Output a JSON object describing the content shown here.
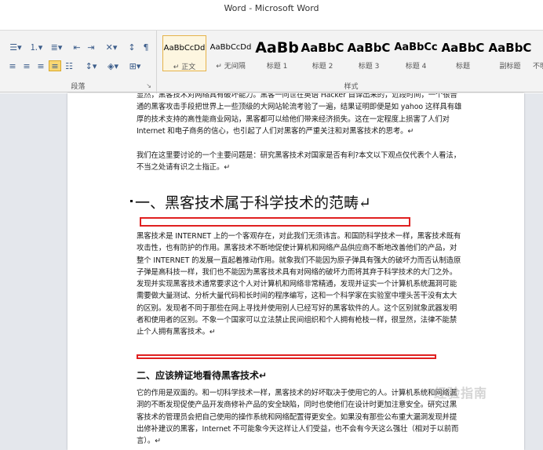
{
  "window": {
    "title": "Word - Microsoft Word"
  },
  "ribbon": {
    "paragraph_group": {
      "label": "段落",
      "icons": [
        "bullets-icon",
        "numbering-icon",
        "multilevel-list-icon",
        "decrease-indent-icon",
        "increase-indent-icon",
        "chinese-layout-icon",
        "sort-icon",
        "show-marks-icon",
        "align-left-icon",
        "align-center-icon",
        "align-right-icon",
        "justify-icon",
        "distributed-icon",
        "line-spacing-icon",
        "shading-icon",
        "borders-icon"
      ]
    },
    "styles_group": {
      "label": "样式",
      "items": [
        {
          "preview": "AaBbCcDd",
          "name": "↵ 正文",
          "selected": true
        },
        {
          "preview": "AaBbCcDd",
          "name": "↵ 无间隔",
          "selected": false
        },
        {
          "preview": "AaBb",
          "name": "标题 1",
          "selected": false
        },
        {
          "preview": "AaBbC",
          "name": "标题 2",
          "selected": false
        },
        {
          "preview": "AaBbC",
          "name": "标题 3",
          "selected": false
        },
        {
          "preview": "AaBbCc",
          "name": "标题 4",
          "selected": false
        },
        {
          "preview": "AaBbC",
          "name": "标题",
          "selected": false
        },
        {
          "preview": "AaBbC",
          "name": "副标题",
          "selected": false
        },
        {
          "preview": "",
          "name": "不明",
          "selected": false
        }
      ]
    }
  },
  "document": {
    "para1": "显然，黑客技术对网络具有破坏能力。黑客一问世在英语 Hacker 首译出来的，近段时间，一个很普通的黑客攻击手段把世界上一些顶级的大网站轮流考验了一遍，结果证明即便是如 yahoo 这样具有雄厚的技术支持的高性能商业网站，黑客都可以给他们带来经济损失。这在一定程度上损害了人们对 Internet 和电子商务的信心，也引起了人们对黑客的严重关注和对黑客技术的思考。↵",
    "para2": "我们在这里要讨论的一个主要问题是：研究黑客技术对国家是否有利?本文以下观点仅代表个人看法，不当之处请有识之士指正。↵",
    "heading1": "一、黑客技术属于科学技术的范畴↵",
    "para3": "黑客技术是 INTERNET 上的一个客观存在，对此我们无须讳言。和国防科学技术一样，黑客技术既有攻击性，也有防护的作用。黑客技术不断地促使计算机和网络产品供应商不断地改善他们的产品，对整个 INTERNET 的发展一直起着推动作用。就象我们不能因为原子弹具有强大的破坏力而否认制造原子弹是高科技一样，我们也不能因为黑客技术具有对网络的破坏力而将其弃于科学技术的大门之外。发现并实现黑客技术通常要求这个人对计算机和网络非常精通，发现并证实一个计算机系统漏洞可能需要做大量测试、分析大量代码和长时间的程序编写，这和一个科学家在实验室中埋头苦干没有太大的区别。发现者不同于那些在网上寻找并使用别人已经写好的黑客软件的人。这个区别就象武器发明者和使用者的区别。不象一个国家可以立法禁止民间组织和个人拥有枪枝一样，很显然，法律不能禁止个人拥有黑客技术。↵",
    "heading2": "二、应该辨证地看待黑客技术↵",
    "para4": "它的作用是双面的。和一切科学技术一样，黑客技术的好坏取决于使用它的人。计算机系统和网络漏洞的不断发现促使产品开发商修补产品的安全缺陷，同时也使他们在设计时更加注意安全。研究过黑客技术的管理员会把自己使用的操作系统和网络配置得更安全。如果没有那些公布重大漏洞发现并提出修补建议的黑客，Internet 不可能象今天这样让人们受益，也不会有今天这么强壮（相对于以前而言）。↵"
  },
  "watermark": "经验指南"
}
